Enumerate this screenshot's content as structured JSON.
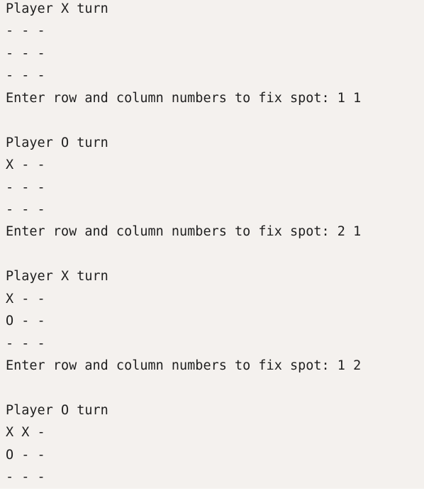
{
  "terminal": {
    "lines": [
      "Player X turn",
      "- - -",
      "- - -",
      "- - -",
      "Enter row and column numbers to fix spot: 1 1",
      "",
      "Player O turn",
      "X - -",
      "- - -",
      "- - -",
      "Enter row and column numbers to fix spot: 2 1",
      "",
      "Player X turn",
      "X - -",
      "O - -",
      "- - -",
      "Enter row and column numbers to fix spot: 1 2",
      "",
      "Player O turn",
      "X X -",
      "O - -",
      "- - -"
    ]
  },
  "colors": {
    "background": "#f4f1ee",
    "text": "#1f1f1f"
  }
}
